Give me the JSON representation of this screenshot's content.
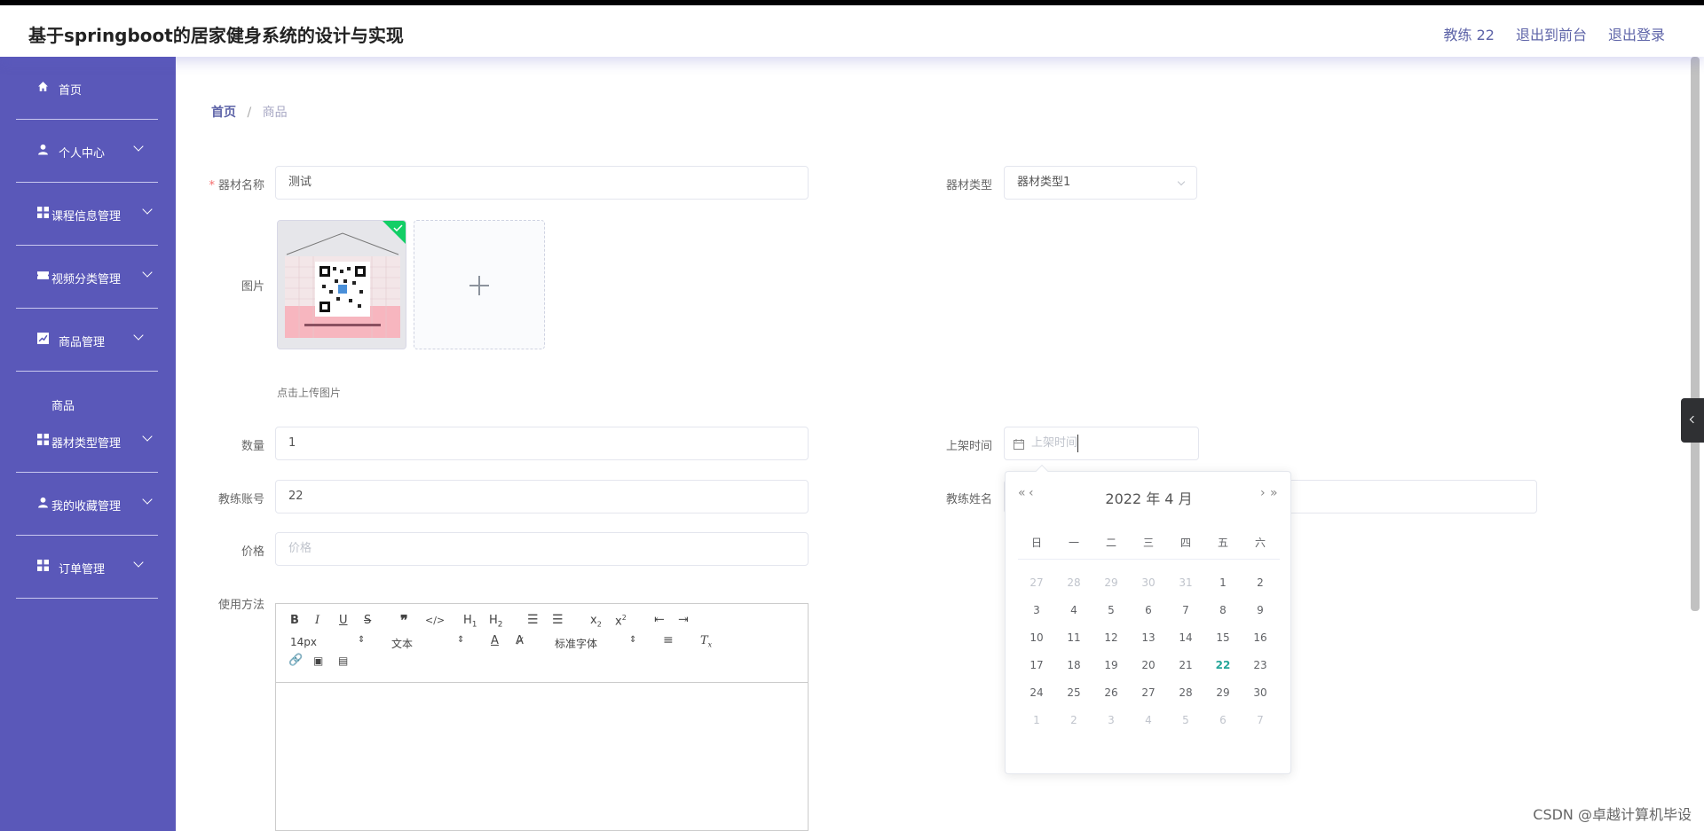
{
  "header": {
    "title": "基于springboot的居家健身系统的设计与实现",
    "user": "教练 22",
    "to_front": "退出到前台",
    "logout": "退出登录"
  },
  "sidebar": {
    "items": [
      {
        "label": "首页",
        "icon": "home-icon"
      },
      {
        "label": "个人中心",
        "icon": "user-icon"
      },
      {
        "label": "课程信息管理",
        "icon": "grid-icon"
      },
      {
        "label": "视频分类管理",
        "icon": "ticket-icon"
      },
      {
        "label": "商品管理",
        "icon": "chart-icon"
      },
      {
        "label": "器材类型管理",
        "icon": "grid-icon"
      },
      {
        "label": "我的收藏管理",
        "icon": "user-icon"
      },
      {
        "label": "订单管理",
        "icon": "grid-icon"
      }
    ],
    "sub_item": "商品"
  },
  "breadcrumb": {
    "home": "首页",
    "sep": "/",
    "current": "商品"
  },
  "form": {
    "name_label": "器材名称",
    "name_value": "测试",
    "type_label": "器材类型",
    "type_value": "器材类型1",
    "image_label": "图片",
    "upload_tip": "点击上传图片",
    "qty_label": "数量",
    "qty_value": "1",
    "shelf_label": "上架时间",
    "shelf_placeholder": "上架时间",
    "coach_account_label": "教练账号",
    "coach_account_value": "22",
    "coach_name_label": "教练姓名",
    "price_label": "价格",
    "price_placeholder": "价格",
    "usage_label": "使用方法"
  },
  "editor": {
    "font_size": "14px",
    "text_format": "文本",
    "font_family": "标准字体"
  },
  "datepicker": {
    "title": "2022 年  4 月",
    "weekdays": [
      "日",
      "一",
      "二",
      "三",
      "四",
      "五",
      "六"
    ],
    "rows": [
      [
        "27",
        "28",
        "29",
        "30",
        "31",
        "1",
        "2"
      ],
      [
        "3",
        "4",
        "5",
        "6",
        "7",
        "8",
        "9"
      ],
      [
        "10",
        "11",
        "12",
        "13",
        "14",
        "15",
        "16"
      ],
      [
        "17",
        "18",
        "19",
        "20",
        "21",
        "22",
        "23"
      ],
      [
        "24",
        "25",
        "26",
        "27",
        "28",
        "29",
        "30"
      ],
      [
        "1",
        "2",
        "3",
        "4",
        "5",
        "6",
        "7"
      ]
    ],
    "today": "22"
  },
  "watermark": "CSDN @卓越计算机毕设",
  "colors": {
    "sidebar": "#5a58b9",
    "accent": "#5e64a8",
    "today": "#26a69a"
  }
}
